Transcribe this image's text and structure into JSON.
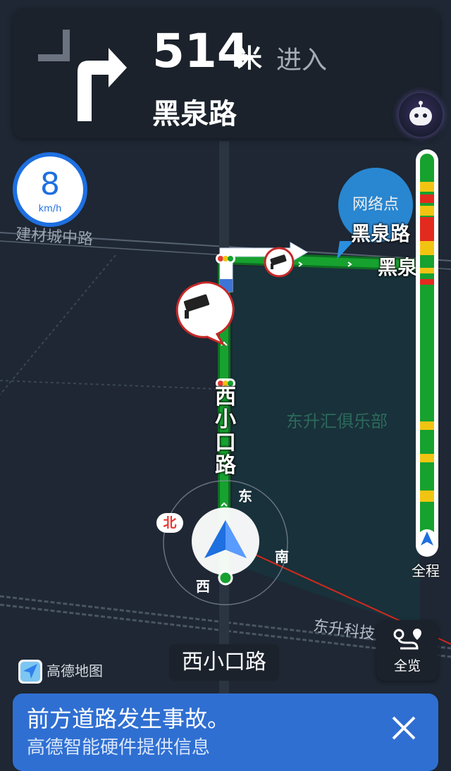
{
  "guidance": {
    "distance": "514",
    "distance_unit": "米",
    "action": "进入",
    "next_road": "黑泉路",
    "turn_direction": "right-turn-icon"
  },
  "speed": {
    "value": "8",
    "unit": "km/h"
  },
  "map": {
    "labels": {
      "road_top_left": "建材城中路",
      "poi_bubble": "网络点",
      "target_road_bubble": "黑泉路",
      "target_road": "黑泉路",
      "current_road_vertical": [
        "西",
        "小",
        "口",
        "路"
      ],
      "poi_club": "东升汇俱乐部",
      "road_bottom_right": "东升科技"
    },
    "compass": {
      "north": "北",
      "east": "东",
      "south": "南",
      "west": "西"
    }
  },
  "progress": {
    "label": "全程"
  },
  "overview": {
    "label": "全览"
  },
  "brand": {
    "name": "高德地图"
  },
  "current_road": "西小口路",
  "alert": {
    "title": "前方道路发生事故。",
    "subtitle": "高德智能硬件提供信息"
  },
  "colors": {
    "route_green": "#17a12f",
    "traffic_yellow": "#f2c412",
    "traffic_red": "#e32a1f",
    "accent_blue": "#1e6fe0",
    "banner_blue": "#2f6fd2"
  }
}
